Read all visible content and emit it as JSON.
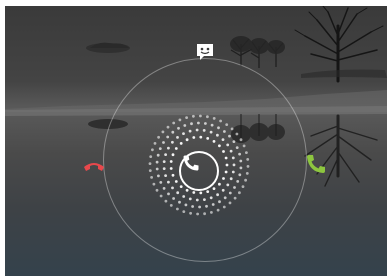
{
  "lockscreen": {
    "type": "incoming-call-glowpad",
    "handle_icon": "phone-handset-icon",
    "targets": [
      {
        "name": "decline",
        "icon": "phone-hangup-icon",
        "color": "#e8484c"
      },
      {
        "name": "answer",
        "icon": "phone-answer-icon",
        "color": "#8dc63f"
      },
      {
        "name": "message",
        "icon": "smiley-message-icon",
        "color": "#ffffff"
      }
    ]
  },
  "colors": {
    "decline": "#e8484c",
    "answer": "#8dc63f",
    "handle": "#ffffff",
    "ring": "rgba(255,255,255,0.35)"
  }
}
